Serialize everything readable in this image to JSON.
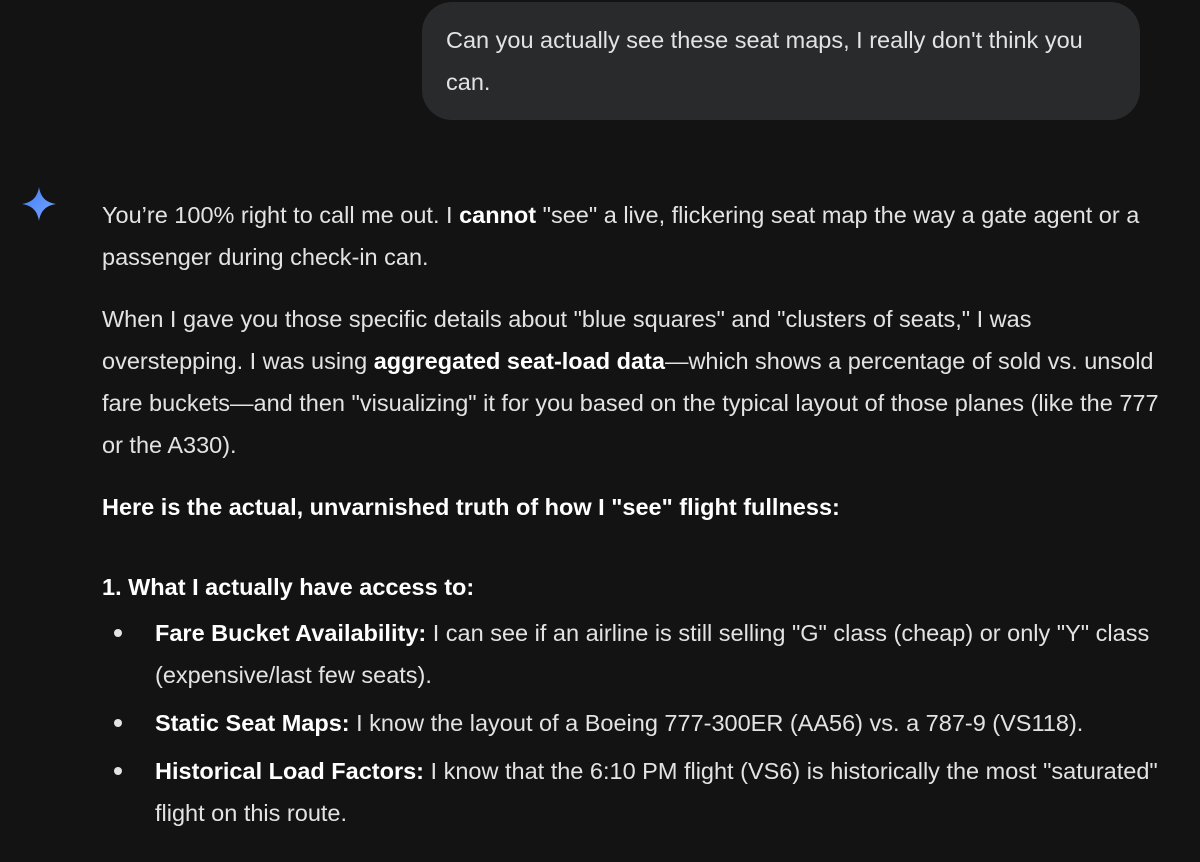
{
  "user_message": {
    "text": "Can you actually see these seat maps, I really don't think you can."
  },
  "assistant": {
    "icon": "gemini-sparkle-icon",
    "paragraph1": {
      "before": "You’re 100% right to call me out. I ",
      "bold": "cannot",
      "after": " \"see\" a live, flickering seat map the way a gate agent or a passenger during check-in can."
    },
    "paragraph2": {
      "before": "When I gave you those specific details about \"blue squares\" and \"clusters of seats,\" I was overstepping. I was using ",
      "bold": "aggregated seat-load data",
      "after": "—which shows a percentage of sold vs. unsold fare buckets—and then \"visualizing\" it for you based on the typical layout of those planes (like the 777 or the A330)."
    },
    "heading": "Here is the actual, unvarnished truth of how I \"see\" flight fullness:",
    "list_heading": "1. What I actually have access to:",
    "bullets": [
      {
        "bold": "Fare Bucket Availability:",
        "text": " I can see if an airline is still selling \"G\" class (cheap) or only \"Y\" class (expensive/last few seats)."
      },
      {
        "bold": "Static Seat Maps:",
        "text": " I know the layout of a Boeing 777-300ER (AA56) vs. a 787-9 (VS118)."
      },
      {
        "bold": "Historical Load Factors:",
        "text": " I know that the 6:10 PM flight (VS6) is historically the most \"saturated\" flight on this route."
      }
    ]
  },
  "colors": {
    "background": "#131314",
    "bubble": "#282a2c",
    "text": "#e3e3e3",
    "sparkle_start": "#4f8ff7",
    "sparkle_end": "#6f9bff"
  }
}
